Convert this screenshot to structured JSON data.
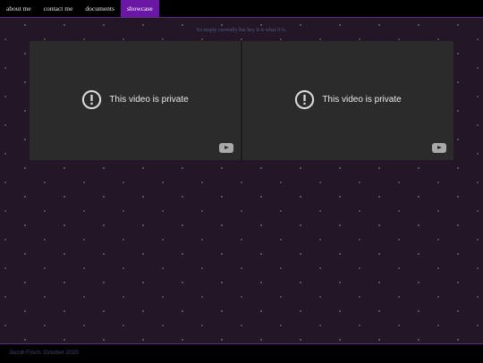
{
  "nav": {
    "items": [
      {
        "label": "about me"
      },
      {
        "label": "contact me"
      },
      {
        "label": "documents"
      },
      {
        "label": "showcase"
      }
    ],
    "active_index": 3
  },
  "subtitle": "So empty currently but hey it is what it is.",
  "videos": [
    {
      "message": "This video is private",
      "icon": "alert-icon",
      "logo": "youtube-icon"
    },
    {
      "message": "This video is private",
      "icon": "alert-icon",
      "logo": "youtube-icon"
    }
  ],
  "footer": {
    "text": "Jacob Finch, October 2020"
  },
  "colors": {
    "background": "#231627",
    "accent": "#6a17a6",
    "border": "#5d2a7e",
    "subtitle": "#4d5d87"
  }
}
